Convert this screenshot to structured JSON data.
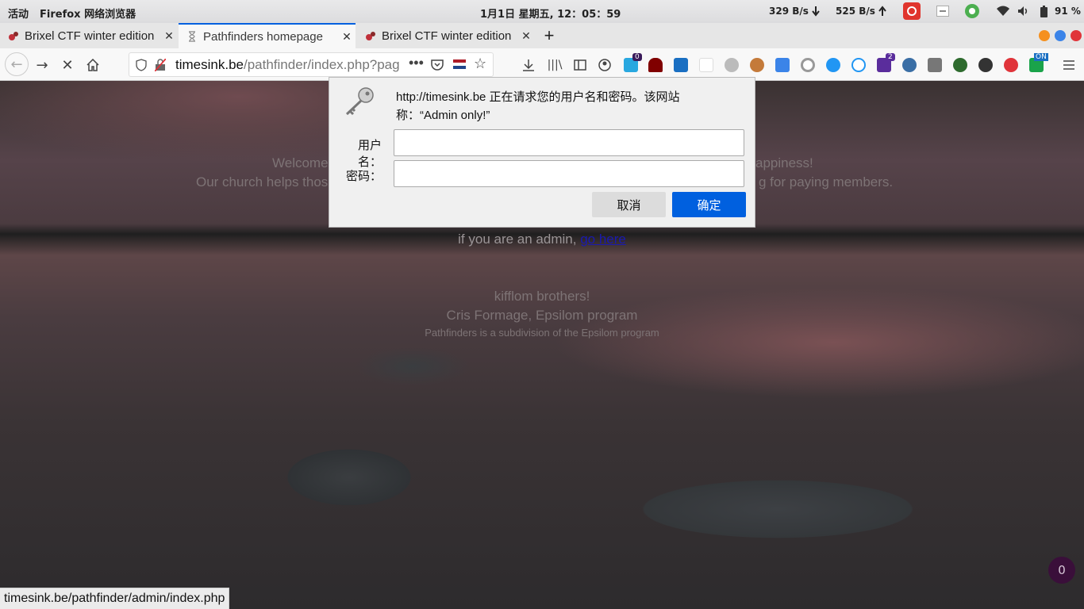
{
  "system_bar": {
    "activities": "活动",
    "app_name": "Firefox 网络浏览器",
    "clock": "1月1日 星期五, 12：05：59",
    "net_down": "329 B/s",
    "net_up": "525 B/s",
    "battery": "91 %"
  },
  "tabs": [
    {
      "label": "Brixel CTF winter edition",
      "active": false
    },
    {
      "label": "Pathfinders homepage",
      "active": true
    },
    {
      "label": "Brixel CTF winter edition",
      "active": false
    }
  ],
  "new_tab_symbol": "+",
  "url": {
    "domain": "timesink.be",
    "path": "/pathfinder/index.php?page"
  },
  "dialog": {
    "message_line1": "http://timesink.be 正在请求您的用户名和密码。该网站",
    "message_line2": "称：“Admin only!”",
    "username_label": "用户名：",
    "password_label": "密码：",
    "username_value": "",
    "password_value": "",
    "cancel_label": "取消",
    "ok_label": "确定"
  },
  "page": {
    "welcome_left": "Welcome",
    "welcome_right": "appiness!",
    "church_left": "Our church helps those",
    "church_right": "g for paying members.",
    "admin_text": "if you are an admin,",
    "admin_link": "go here",
    "kifflom": "kifflom brothers!",
    "signature": "Cris Formage, Epsilom program",
    "subdivision": "Pathfinders is a subdivision of the Epsilom program"
  },
  "extension_badges": {
    "notif": "0",
    "purple": "2",
    "on": "ON"
  },
  "status_url": "timesink.be/pathfinder/admin/index.php",
  "floating_badge": "0",
  "colors": {
    "accent": "#0060df",
    "dialog_bg": "#f0f0f0",
    "window_close": "#e0343a",
    "window_max": "#3b84e8",
    "window_min": "#f5901e"
  }
}
